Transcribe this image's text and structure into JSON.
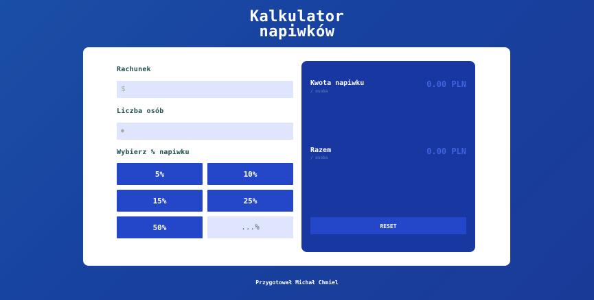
{
  "header": {
    "title_line1": "Kalkulator",
    "title_line2": "napiwków"
  },
  "form": {
    "bill_label": "Rachunek",
    "bill_icon": "dollar-icon",
    "bill_icon_glyph": "$",
    "bill_value": "",
    "people_label": "Liczba osób",
    "people_icon": "person-icon",
    "people_icon_glyph": "●",
    "people_value": "",
    "tip_label": "Wybierz % napiwku",
    "tips": [
      "5%",
      "10%",
      "15%",
      "25%",
      "50%"
    ],
    "custom_tip_placeholder": "...%"
  },
  "results": {
    "tip_amount_label": "Kwota napiwku",
    "tip_amount_sub": "/ osoba",
    "tip_amount_value": "0.00 PLN",
    "total_label": "Razem",
    "total_sub": "/ osoba",
    "total_value": "0.00 PLN",
    "reset_label": "RESET"
  },
  "footer": {
    "credit": "Przygotował Michał Chmiel"
  },
  "colors": {
    "background": "#1a47a3",
    "accent": "#2347c8",
    "panel": "#1837a0",
    "input_bg": "#dfe5fd",
    "result_value": "#3f63e0"
  }
}
